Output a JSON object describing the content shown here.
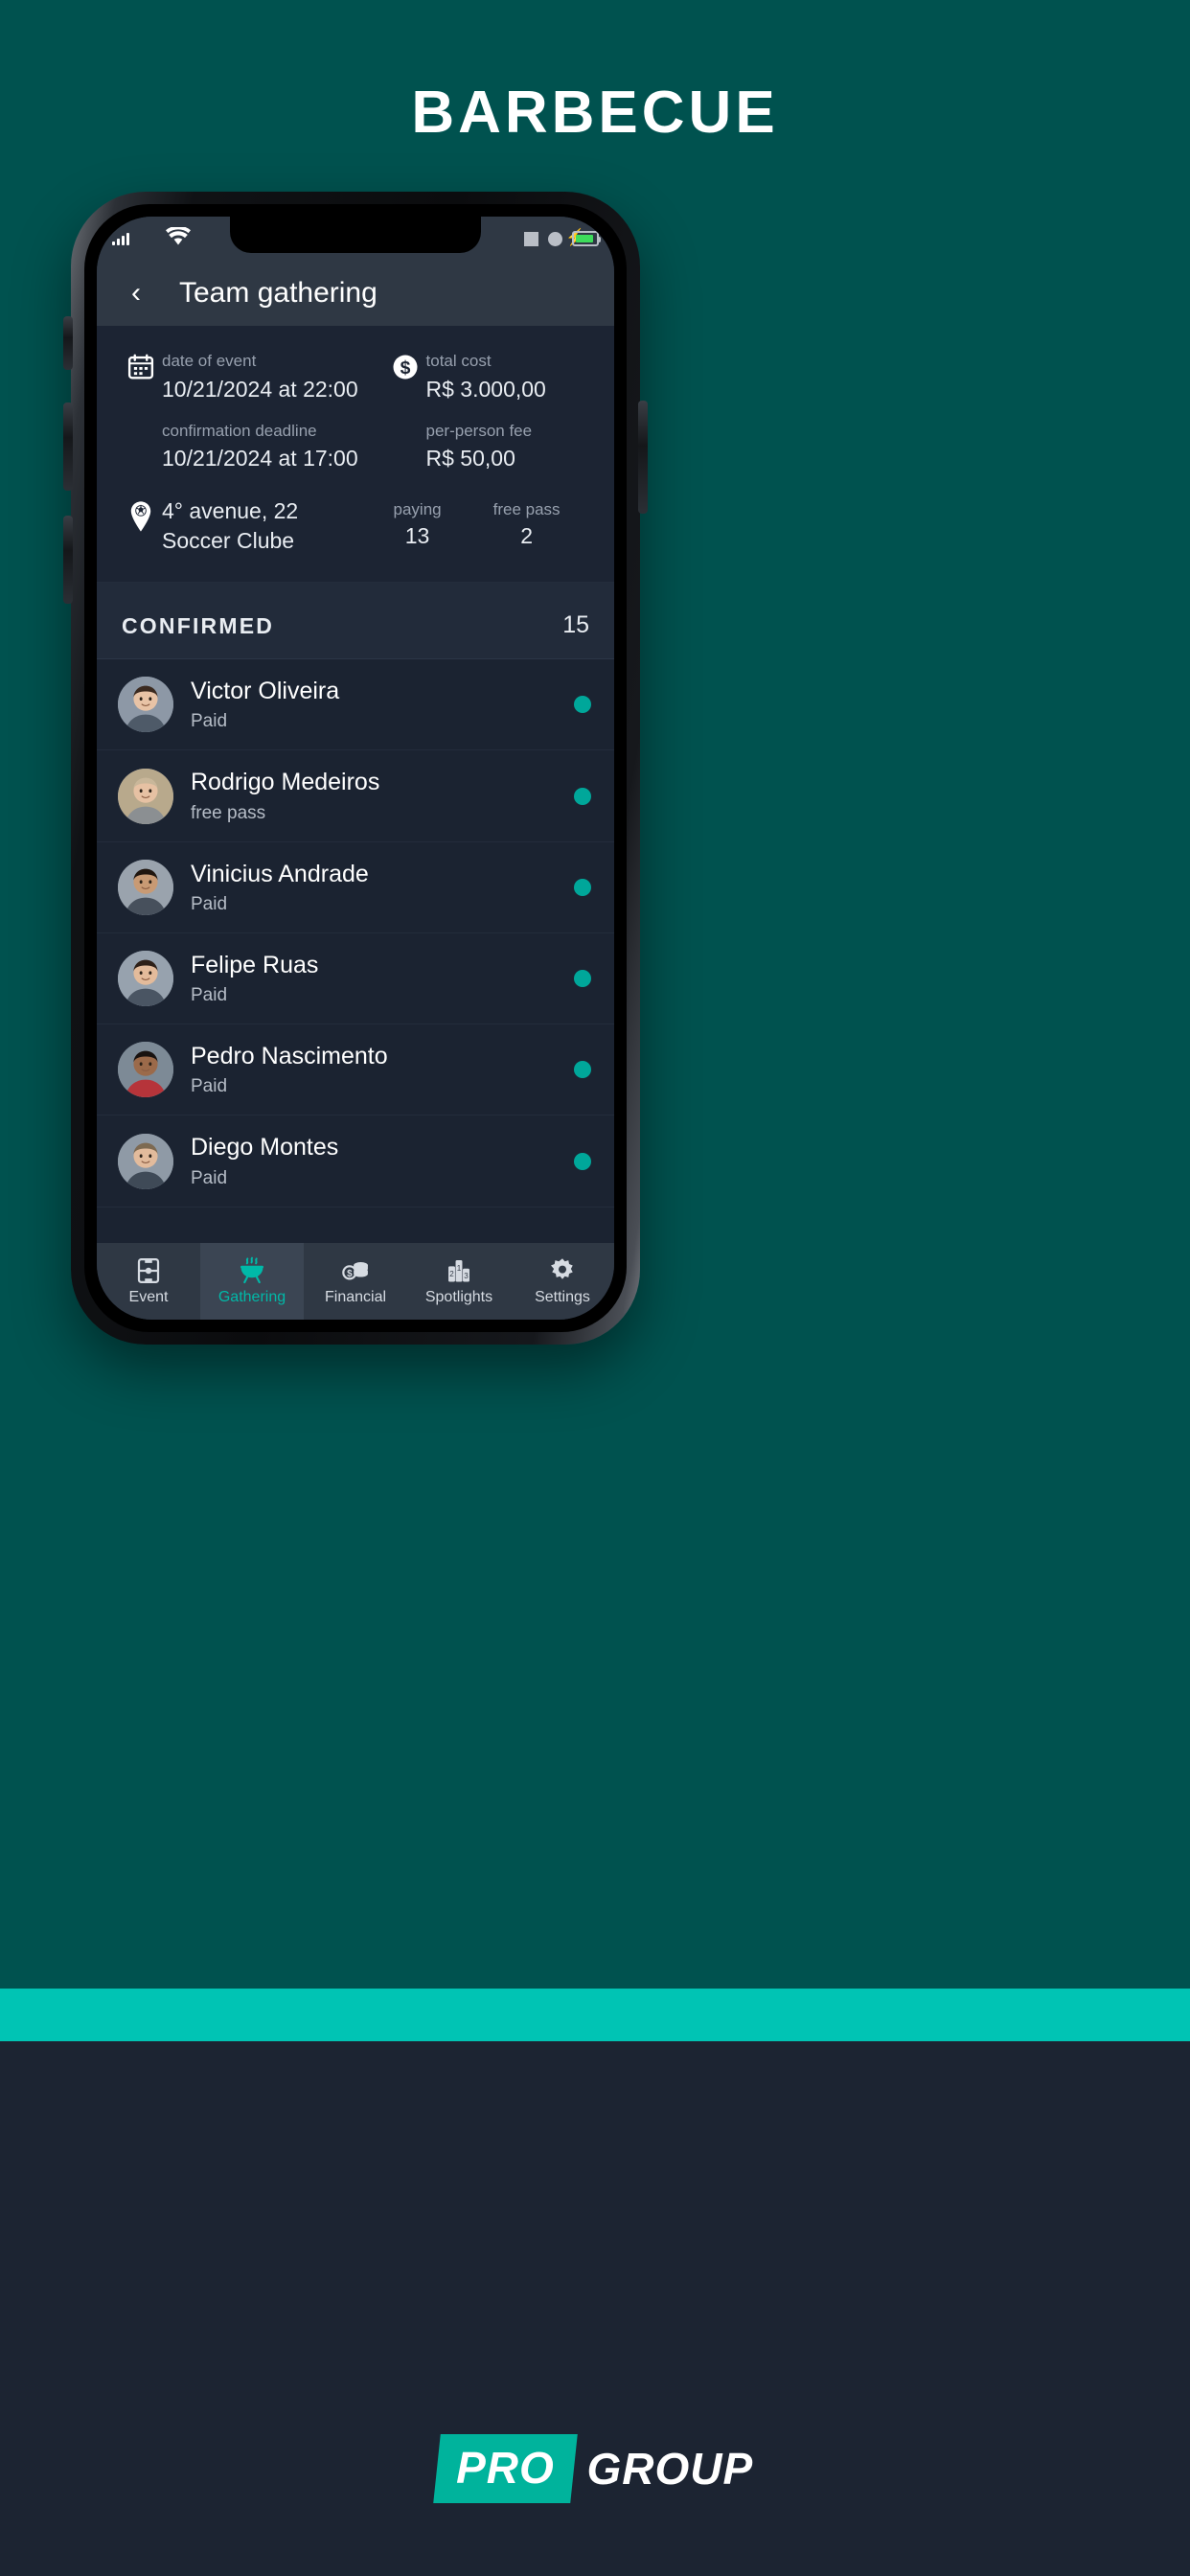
{
  "promo": {
    "title": "BARBECUE",
    "background_color": "#00524f",
    "accent_band_color": "#00c4b4",
    "footer_bg_color": "#1c2432",
    "logo": {
      "badge_text": "PRO",
      "word_text": "GROUP",
      "badge_color": "#00b39c"
    }
  },
  "status_bar": {
    "signal_icon": "signal-bars-icon",
    "wifi_icon": "wifi-icon",
    "square_icon": "square-indicator-icon",
    "circle_icon": "circle-indicator-icon",
    "battery_icon": "battery-charging-icon",
    "battery_color": "#3ddc5b"
  },
  "appbar": {
    "back_icon": "chevron-left-icon",
    "title": "Team gathering"
  },
  "event_info": {
    "calendar_icon": "calendar-icon",
    "money_icon": "dollar-circle-icon",
    "location_icon": "map-pin-soccer-icon",
    "date_label": "date of event",
    "date_value": "10/21/2024 at 22:00",
    "deadline_label": "confirmation deadline",
    "deadline_value": "10/21/2024 at 17:00",
    "total_cost_label": "total cost",
    "total_cost_value": "R$ 3.000,00",
    "per_person_label": "per-person fee",
    "per_person_value": "R$ 50,00",
    "address_line1": "4° avenue, 22",
    "address_line2": "Soccer Clube",
    "paying_label": "paying",
    "paying_value": "13",
    "free_pass_label": "free pass",
    "free_pass_value": "2"
  },
  "confirmed_section": {
    "title": "CONFIRMED",
    "count": "15"
  },
  "attendees": [
    {
      "name": "Victor Oliveira",
      "status": "Paid",
      "dot_color": "#00a79a",
      "avatar": "avatar-victor"
    },
    {
      "name": "Rodrigo Medeiros",
      "status": "free pass",
      "dot_color": "#00a79a",
      "avatar": "avatar-rodrigo"
    },
    {
      "name": "Vinicius Andrade",
      "status": "Paid",
      "dot_color": "#00a79a",
      "avatar": "avatar-vinicius"
    },
    {
      "name": "Felipe Ruas",
      "status": "Paid",
      "dot_color": "#00a79a",
      "avatar": "avatar-felipe"
    },
    {
      "name": "Pedro Nascimento",
      "status": "Paid",
      "dot_color": "#00a79a",
      "avatar": "avatar-pedro"
    },
    {
      "name": "Diego Montes",
      "status": "Paid",
      "dot_color": "#00a79a",
      "avatar": "avatar-diego"
    }
  ],
  "bottom_nav": {
    "active_index": 1,
    "active_color": "#00b9a8",
    "items": [
      {
        "label": "Event",
        "icon": "soccer-field-icon"
      },
      {
        "label": "Gathering",
        "icon": "barbecue-grill-icon"
      },
      {
        "label": "Financial",
        "icon": "coins-icon"
      },
      {
        "label": "Spotlights",
        "icon": "podium-icon"
      },
      {
        "label": "Settings",
        "icon": "gear-icon"
      }
    ]
  }
}
